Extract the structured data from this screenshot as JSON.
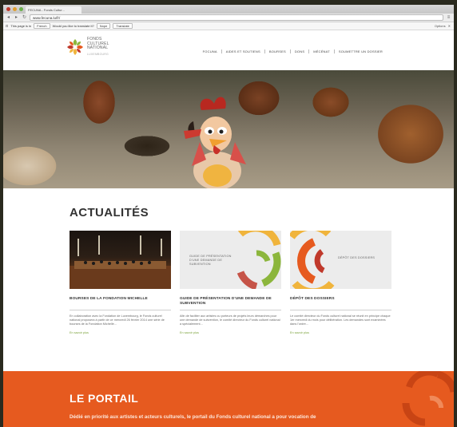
{
  "browser": {
    "tab_title": "FECUNA - Fonds Cultur...",
    "url": "www.fecuna.lu/fr/",
    "translate_bar": {
      "label": "This page is in",
      "language": "French",
      "question": "Would you like to translate it?",
      "nope_button": "Nope",
      "translate_button": "Translate",
      "options_button": "Options"
    }
  },
  "site": {
    "logo_line1": "FONDS",
    "logo_line2": "CULTUREL",
    "logo_line3": "NATIONAL",
    "logo_sub": "LUXEMBOURG",
    "brand_colors": {
      "green": "#8cb63c",
      "orange": "#e65a1f",
      "red": "#c0392b",
      "yellow": "#f0b43c"
    },
    "nav": [
      "FOCUNA",
      "AIDES ET SOUTIENS",
      "BOURSES",
      "DONS",
      "MÉCÉNAT",
      "SOUMETTRE UN DOSSIER"
    ]
  },
  "news": {
    "heading": "ACTUALITÉS",
    "cards": [
      {
        "image_caption": "",
        "title": "BOURSES DE LA FONDATION MICHELLE",
        "body": "En collaboration avec la Fondation de Luxembourg, le Fonds culturel national proposera à partir de ce mercredi 26 février 2014 une série de bourses de la Fondation Michelle...",
        "more": "En savoir plus"
      },
      {
        "image_caption": "GUIDE DE PRÉSENTATION D'UNE DEMANDE DE SUBVENTION",
        "title": "GUIDE DE PRÉSENTATION D'UNE DEMANDE DE SUBVENTION",
        "body": "Afin de faciliter aux artistes ou porteurs de projets leurs démarches pour une demande de subvention, le comité directeur du Fonds culturel national a spécialement...",
        "more": "En savoir plus"
      },
      {
        "image_caption": "DÉPÔT DES DOSSIERS",
        "title": "DÉPÔT DES DOSSIERS",
        "body": "Le comité directeur du Fonds culturel national se réunit en principe chaque 1er mercredi du mois pour délibération. Les demandes sont examinées dans l'ordre...",
        "more": "En savoir plus"
      }
    ]
  },
  "portal": {
    "heading": "LE PORTAIL",
    "text": "Dédié en priorité aux artistes et acteurs culturels, le portail du Fonds culturel national a pour vocation de"
  }
}
